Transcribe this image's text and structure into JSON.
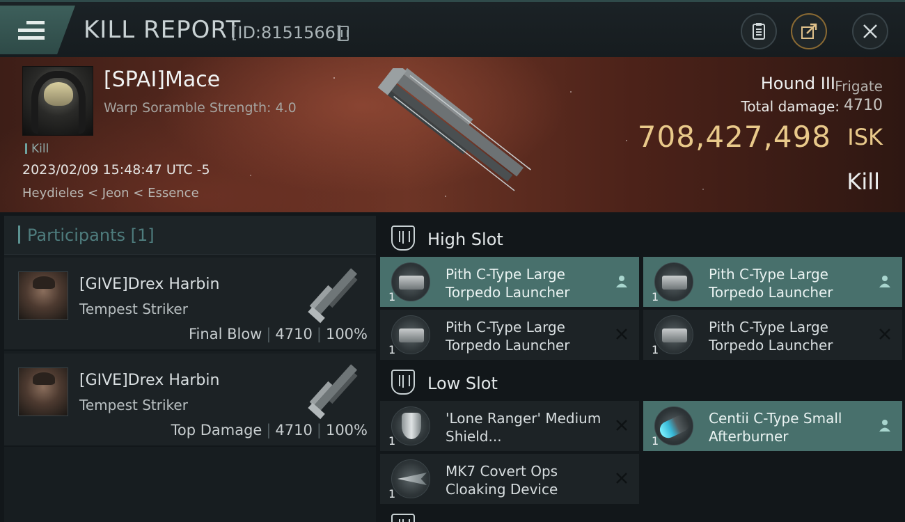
{
  "header": {
    "title": "KILL REPORT",
    "kill_id": "[ID:8151566]"
  },
  "victim": {
    "name": "[SPAI]Mace",
    "subtitle": "Warp Soramble Strength: 4.0",
    "tag": "Kill",
    "datetime": "2023/02/09 15:48:47 UTC -5",
    "location": "Heydieles < Jeon < Essence",
    "ship_name": "Hound III",
    "ship_class": "Frigate",
    "total_damage_label": "Total damage:",
    "total_damage": "4710",
    "isk_value": "708,427,498",
    "isk_unit": "ISK",
    "result": "Kill"
  },
  "participants": {
    "title": "Participants",
    "count": "[1]",
    "items": [
      {
        "name": "[GIVE]Drex Harbin",
        "ship": "Tempest Striker",
        "role": "Final Blow",
        "damage": "4710",
        "percent": "100%"
      },
      {
        "name": "[GIVE]Drex Harbin",
        "ship": "Tempest Striker",
        "role": "Top Damage",
        "damage": "4710",
        "percent": "100%"
      }
    ],
    "separator": "|"
  },
  "slots": {
    "high": {
      "title": "High Slot",
      "modules": [
        {
          "name": "Pith C-Type Large Torpedo Launcher",
          "qty": "1",
          "status": "dropped"
        },
        {
          "name": "Pith C-Type Large Torpedo Launcher",
          "qty": "1",
          "status": "dropped"
        },
        {
          "name": "Pith C-Type Large Torpedo Launcher",
          "qty": "1",
          "status": "destroyed"
        },
        {
          "name": "Pith C-Type Large Torpedo Launcher",
          "qty": "1",
          "status": "destroyed"
        }
      ]
    },
    "low": {
      "title": "Low Slot",
      "modules": [
        {
          "name": "'Lone Ranger' Medium Shield...",
          "qty": "1",
          "status": "destroyed"
        },
        {
          "name": "Centii C-Type Small Afterburner",
          "qty": "1",
          "status": "dropped"
        },
        {
          "name": "MK7 Covert Ops Cloaking Device",
          "qty": "1",
          "status": "destroyed"
        }
      ]
    }
  },
  "colors": {
    "accent": "#48706c",
    "isk": "#e9c98a",
    "participants_title": "#4e7c7d"
  },
  "icons": {
    "menu": "menu-icon",
    "clipboard": "clipboard-icon",
    "share": "share-icon",
    "close": "close-icon",
    "copy": "copy-icon"
  }
}
